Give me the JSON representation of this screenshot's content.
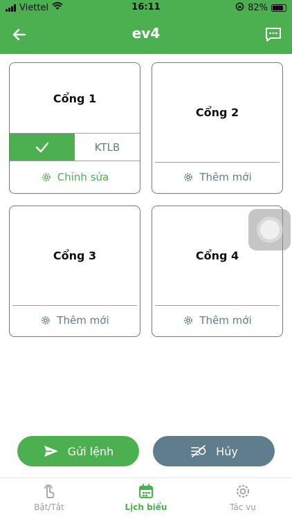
{
  "status_bar": {
    "carrier": "Viettel",
    "time": "16:11",
    "battery": "82%",
    "battery_level": 0.82
  },
  "header": {
    "title": "ev4"
  },
  "colors": {
    "primary": "#4caf50",
    "secondary": "#5f7d8c",
    "muted": "#607d8b"
  },
  "cards": [
    {
      "title": "Cổng 1",
      "toggle_label": "KTLB",
      "toggle_on": true,
      "action_label": "Chỉnh sửa"
    },
    {
      "title": "Cổng 2",
      "action_label": "Thêm mới"
    },
    {
      "title": "Cổng 3",
      "action_label": "Thêm mới"
    },
    {
      "title": "Cổng 4",
      "action_label": "Thêm mới"
    }
  ],
  "actions": {
    "send_label": "Gửi lệnh",
    "cancel_label": "Hủy"
  },
  "tabs": [
    {
      "label": "Bật/Tắt",
      "icon": "touch-icon",
      "active": false
    },
    {
      "label": "Lịch biểu",
      "icon": "calendar-icon",
      "active": true
    },
    {
      "label": "Tác vụ",
      "icon": "gear-icon",
      "active": false
    }
  ]
}
